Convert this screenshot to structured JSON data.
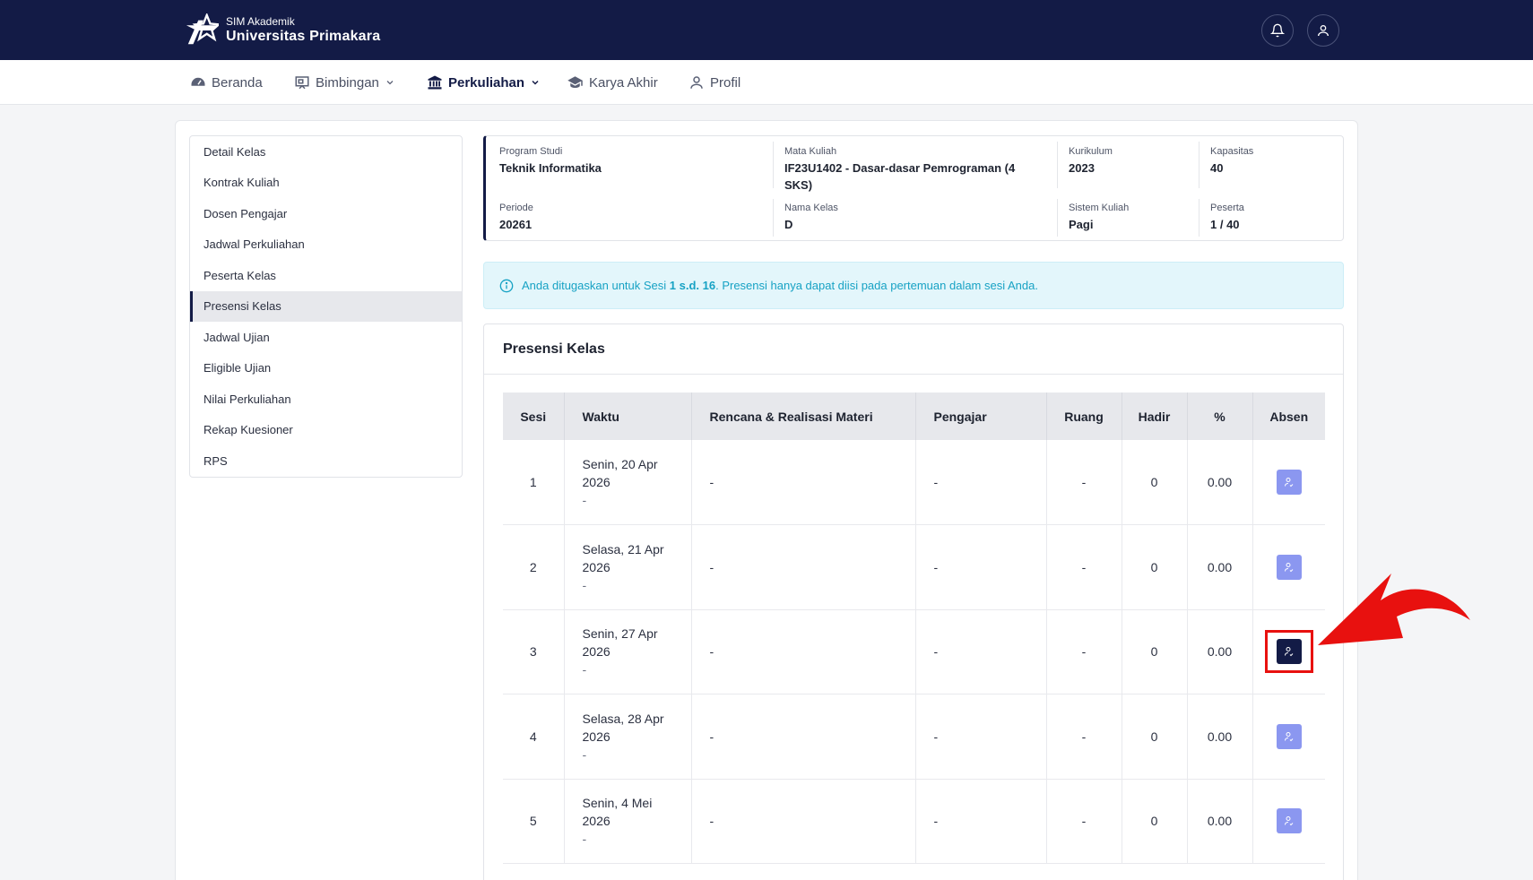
{
  "brand": {
    "subtitle": "SIM Akademik",
    "title": "Universitas Primakara"
  },
  "nav": [
    {
      "label": "Beranda",
      "icon": "dashboard-icon",
      "active": false
    },
    {
      "label": "Bimbingan",
      "icon": "presentation-icon",
      "active": false,
      "dropdown": true
    },
    {
      "label": "Perkuliahan",
      "icon": "institution-icon",
      "active": true,
      "dropdown": true
    },
    {
      "label": "Karya Akhir",
      "icon": "graduation-cap-icon",
      "active": false
    },
    {
      "label": "Profil",
      "icon": "user-icon",
      "active": false
    }
  ],
  "sidebar": {
    "items": [
      {
        "label": "Detail Kelas"
      },
      {
        "label": "Kontrak Kuliah"
      },
      {
        "label": "Dosen Pengajar"
      },
      {
        "label": "Jadwal Perkuliahan"
      },
      {
        "label": "Peserta Kelas"
      },
      {
        "label": "Presensi Kelas",
        "active": true
      },
      {
        "label": "Jadwal Ujian"
      },
      {
        "label": "Eligible Ujian"
      },
      {
        "label": "Nilai Perkuliahan"
      },
      {
        "label": "Rekap Kuesioner"
      },
      {
        "label": "RPS"
      }
    ]
  },
  "info": {
    "program_studi": {
      "label": "Program Studi",
      "value": "Teknik Informatika"
    },
    "mata_kuliah": {
      "label": "Mata Kuliah",
      "value_line1": "IF23U1402 - Dasar-dasar Pemrograman (4",
      "value_line2": "SKS)"
    },
    "kurikulum": {
      "label": "Kurikulum",
      "value": "2023"
    },
    "kapasitas": {
      "label": "Kapasitas",
      "value": "40"
    },
    "periode": {
      "label": "Periode",
      "value": "20261"
    },
    "nama_kelas": {
      "label": "Nama Kelas",
      "value": "D"
    },
    "sistem_kuliah": {
      "label": "Sistem Kuliah",
      "value": "Pagi"
    },
    "peserta": {
      "label": "Peserta",
      "value": "1 / 40"
    }
  },
  "alert": {
    "text_before": "Anda ditugaskan untuk Sesi ",
    "bold": "1 s.d. 16",
    "text_after": ". Presensi hanya dapat diisi pada pertemuan dalam sesi Anda."
  },
  "presensi": {
    "title": "Presensi Kelas",
    "headers": [
      "Sesi",
      "Waktu",
      "Rencana & Realisasi Materi",
      "Pengajar",
      "Ruang",
      "Hadir",
      "%",
      "Absen"
    ],
    "rows": [
      {
        "sesi": "1",
        "waktu_1": "Senin, 20 Apr",
        "waktu_2": "2026",
        "waktu_3": "-",
        "materi": "-",
        "pengajar": "-",
        "ruang": "-",
        "hadir": "0",
        "persen": "0.00"
      },
      {
        "sesi": "2",
        "waktu_1": "Selasa, 21 Apr",
        "waktu_2": "2026",
        "waktu_3": "-",
        "materi": "-",
        "pengajar": "-",
        "ruang": "-",
        "hadir": "0",
        "persen": "0.00"
      },
      {
        "sesi": "3",
        "waktu_1": "Senin, 27 Apr",
        "waktu_2": "2026",
        "waktu_3": "-",
        "materi": "-",
        "pengajar": "-",
        "ruang": "-",
        "hadir": "0",
        "persen": "0.00"
      },
      {
        "sesi": "4",
        "waktu_1": "Selasa, 28 Apr",
        "waktu_2": "2026",
        "waktu_3": "-",
        "materi": "-",
        "pengajar": "-",
        "ruang": "-",
        "hadir": "0",
        "persen": "0.00"
      },
      {
        "sesi": "5",
        "waktu_1": "Senin, 4 Mei",
        "waktu_2": "2026",
        "waktu_3": "-",
        "materi": "-",
        "pengajar": "-",
        "ruang": "-",
        "hadir": "0",
        "persen": "0.00"
      }
    ]
  },
  "colors": {
    "primary": "#131b46",
    "absen_button": "#8b97f0",
    "alert_text": "#17a2c4",
    "annotation": "#e8110f"
  }
}
